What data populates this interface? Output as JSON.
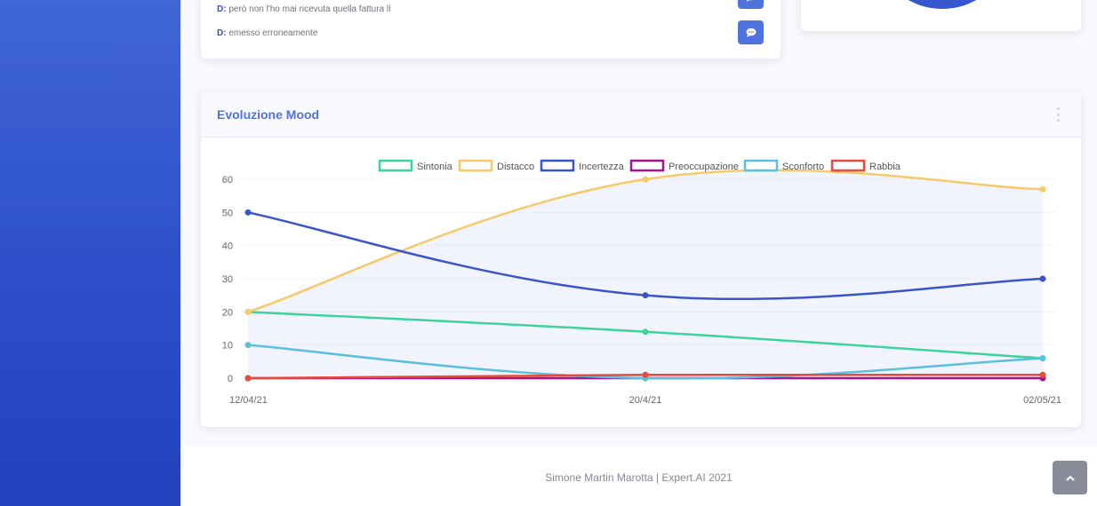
{
  "messages": [
    {
      "speaker": "D:",
      "text": "però non l'ho mai ricevuta quella fattura lì"
    },
    {
      "speaker": "D:",
      "text": "emesso erroneamente"
    }
  ],
  "mood_chart": {
    "title": "Evoluzione Mood",
    "menu_icon": "ellipsis-vertical-icon"
  },
  "chart_data": {
    "type": "line",
    "x": [
      "12/04/21",
      "20/4/21",
      "02/05/21"
    ],
    "ylim": [
      0,
      60
    ],
    "yticks": [
      0,
      10,
      20,
      30,
      40,
      50,
      60
    ],
    "grid": true,
    "legend_position": "top",
    "series": [
      {
        "name": "Sintonia",
        "color": "#3dd39a",
        "values": [
          20,
          14,
          6
        ]
      },
      {
        "name": "Distacco",
        "color": "#f6c96a",
        "values": [
          20,
          60,
          57
        ]
      },
      {
        "name": "Incertezza",
        "color": "#3a55c8",
        "values": [
          50,
          25,
          30
        ]
      },
      {
        "name": "Preoccupazione",
        "color": "#a7148a",
        "values": [
          0,
          0,
          0
        ]
      },
      {
        "name": "Sconforto",
        "color": "#5bc0de",
        "values": [
          10,
          0,
          6
        ]
      },
      {
        "name": "Rabbia",
        "color": "#e74a3b",
        "values": [
          0,
          1,
          1
        ]
      }
    ]
  },
  "footer": {
    "text": "Simone Martin Marotta | Expert.AI 2021"
  },
  "scroll_top": {
    "icon": "chevron-up-icon"
  }
}
